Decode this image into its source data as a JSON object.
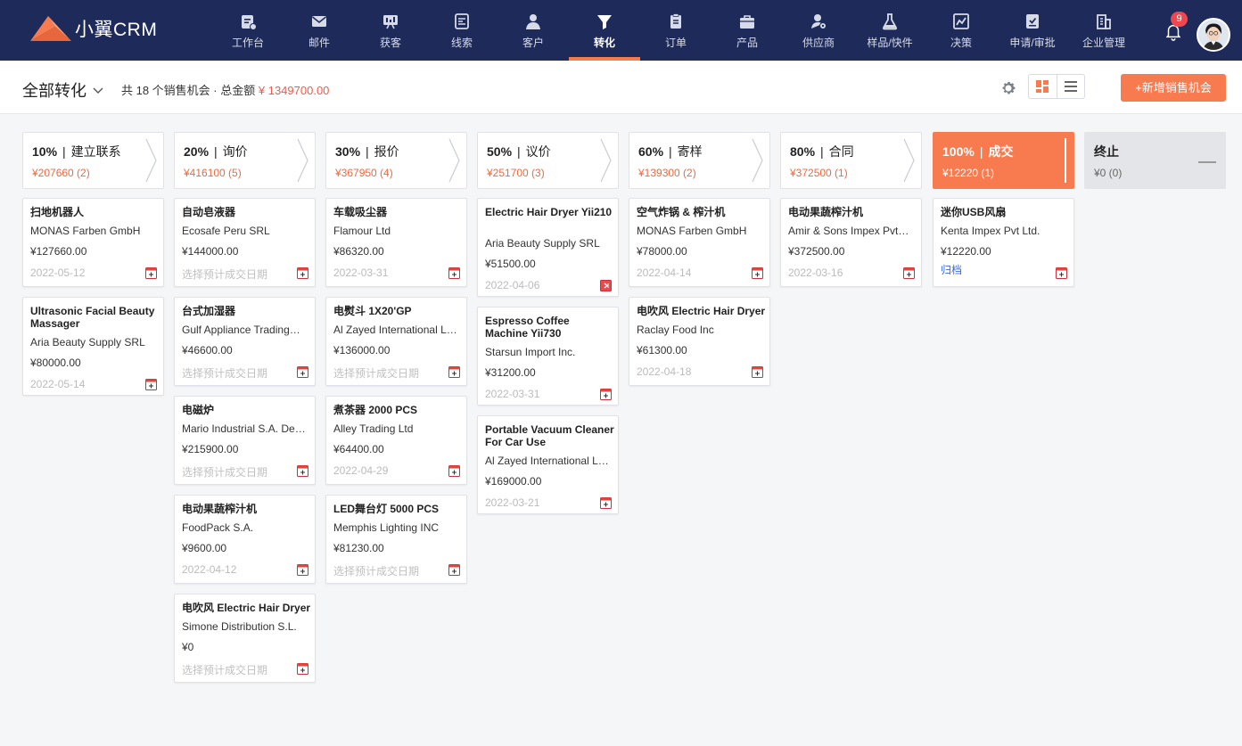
{
  "brand": {
    "name": "小翼CRM"
  },
  "nav": {
    "items": [
      {
        "label": "工作台",
        "icon": "workbench-icon"
      },
      {
        "label": "邮件",
        "icon": "mail-icon"
      },
      {
        "label": "获客",
        "icon": "acquire-icon"
      },
      {
        "label": "线索",
        "icon": "leads-icon"
      },
      {
        "label": "客户",
        "icon": "customer-icon"
      },
      {
        "label": "转化",
        "icon": "funnel-icon"
      },
      {
        "label": "订单",
        "icon": "order-icon"
      },
      {
        "label": "产品",
        "icon": "product-icon"
      },
      {
        "label": "供应商",
        "icon": "supplier-icon"
      },
      {
        "label": "样品/快件",
        "icon": "sample-icon"
      },
      {
        "label": "决策",
        "icon": "decision-icon"
      },
      {
        "label": "申请/审批",
        "icon": "approval-icon"
      },
      {
        "label": "企业管理",
        "icon": "enterprise-icon"
      }
    ],
    "active": "转化",
    "notifications": "9"
  },
  "header": {
    "view_title": "全部转化",
    "summary_prefix": "共 18 个销售机会 · 总金额",
    "summary_amount": "¥ 1349700.00",
    "add_button": "+新增销售机会"
  },
  "stages": [
    {
      "pct": "10%",
      "name": "建立联系",
      "sub": "¥207660 (2)"
    },
    {
      "pct": "20%",
      "name": "询价",
      "sub": "¥416100 (5)"
    },
    {
      "pct": "30%",
      "name": "报价",
      "sub": "¥367950 (4)"
    },
    {
      "pct": "50%",
      "name": "议价",
      "sub": "¥251700 (3)"
    },
    {
      "pct": "60%",
      "name": "寄样",
      "sub": "¥139300 (2)"
    },
    {
      "pct": "80%",
      "name": "合同",
      "sub": "¥372500 (1)"
    },
    {
      "pct": "100%",
      "name": "成交",
      "sub": "¥12220 (1)"
    },
    {
      "pct": "",
      "name": "终止",
      "sub": "¥0 (0)"
    }
  ],
  "cards": [
    [
      {
        "title": "扫地机器人",
        "company": "MONAS Farben GmbH",
        "amount": "¥127660.00",
        "date": "2022-05-12"
      },
      {
        "title": "Ultrasonic Facial Beauty Massager",
        "company": "Aria Beauty Supply SRL",
        "amount": "¥80000.00",
        "date": "2022-05-14"
      }
    ],
    [
      {
        "title": "自动皂液器",
        "company": "Ecosafe Peru SRL",
        "amount": "¥144000.00",
        "date": "选择预计成交日期"
      },
      {
        "title": "台式加湿器",
        "company": "Gulf Appliance Trading…",
        "amount": "¥46600.00",
        "date": "选择预计成交日期"
      },
      {
        "title": "电磁炉",
        "company": "Mario Industrial S.A. De…",
        "amount": "¥215900.00",
        "date": "选择预计成交日期"
      },
      {
        "title": "电动果蔬榨汁机",
        "company": "FoodPack S.A.",
        "amount": "¥9600.00",
        "date": "2022-04-12"
      },
      {
        "title": "电吹风 Electric Hair Dryer",
        "company": "Simone Distribution S.L.",
        "amount": "¥0",
        "date": "选择预计成交日期"
      }
    ],
    [
      {
        "title": "车载吸尘器",
        "company": "Flamour Ltd",
        "amount": "¥86320.00",
        "date": "2022-03-31"
      },
      {
        "title": "电熨斗 1X20'GP",
        "company": "Al Zayed International LLC",
        "amount": "¥136000.00",
        "date": "选择预计成交日期"
      },
      {
        "title": "煮茶器 2000 PCS",
        "company": "Alley Trading Ltd",
        "amount": "¥64400.00",
        "date": "2022-04-29"
      },
      {
        "title": "LED舞台灯 5000 PCS",
        "company": "Memphis Lighting INC",
        "amount": "¥81230.00",
        "date": "选择预计成交日期"
      }
    ],
    [
      {
        "title": "Electric Hair Dryer Yii210",
        "company": "Aria Beauty Supply SRL",
        "amount": "¥51500.00",
        "date": "2022-04-06"
      },
      {
        "title": "Espresso Coffee Machine Yii730",
        "company": "Starsun Import Inc.",
        "amount": "¥31200.00",
        "date": "2022-03-31"
      },
      {
        "title": "Portable Vacuum Cleaner For Car Use",
        "company": "Al Zayed International LLC",
        "amount": "¥169000.00",
        "date": "2022-03-21"
      }
    ],
    [
      {
        "title": "空气炸锅 & 榨汁机",
        "company": "MONAS Farben GmbH",
        "amount": "¥78000.00",
        "date": "2022-04-14"
      },
      {
        "title": "电吹风 Electric Hair Dryer",
        "company": "Raclay Food Inc",
        "amount": "¥61300.00",
        "date": "2022-04-18"
      }
    ],
    [
      {
        "title": "电动果蔬榨汁机",
        "company": "Amir & Sons Impex Pvt…",
        "amount": "¥372500.00",
        "date": "2022-03-16"
      }
    ],
    [
      {
        "title": "迷你USB风扇",
        "company": "Kenta Impex Pvt Ltd.",
        "amount": "¥12220.00",
        "date": "归档"
      }
    ],
    []
  ],
  "colors": {
    "nav_bg": "#1e2a5a",
    "accent": "#f77b4e",
    "amount_red": "#f05a4a"
  }
}
